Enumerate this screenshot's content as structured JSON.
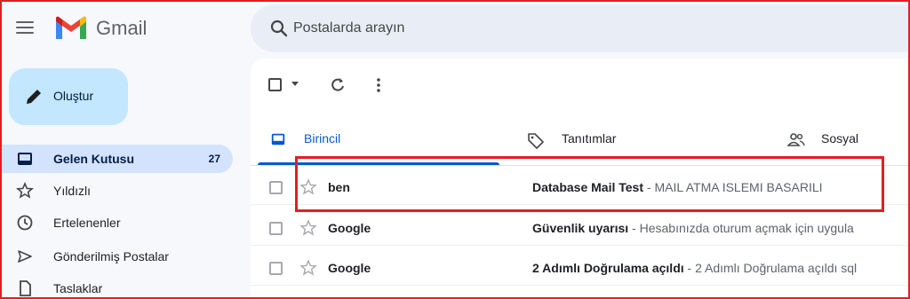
{
  "header": {
    "brand": "Gmail",
    "search_placeholder": "Postalarda arayın"
  },
  "sidebar": {
    "compose_label": "Oluştur",
    "items": [
      {
        "label": "Gelen Kutusu",
        "count": "27",
        "icon": "inbox-icon",
        "active": true
      },
      {
        "label": "Yıldızlı",
        "icon": "star-icon"
      },
      {
        "label": "Ertelenenler",
        "icon": "clock-icon"
      },
      {
        "label": "Gönderilmiş Postalar",
        "icon": "send-icon"
      },
      {
        "label": "Taslaklar",
        "icon": "draft-icon"
      }
    ]
  },
  "tabs": [
    {
      "label": "Birincil",
      "icon": "inbox-icon",
      "active": true
    },
    {
      "label": "Tanıtımlar",
      "icon": "tag-icon"
    },
    {
      "label": "Sosyal",
      "icon": "people-icon"
    }
  ],
  "emails": [
    {
      "sender": "ben",
      "subject": "Database Mail Test",
      "snippet": " - MAIL ATMA ISLEMI BASARILI"
    },
    {
      "sender": "Google",
      "subject": "Güvenlik uyarısı",
      "snippet": " - Hesabınızda oturum açmak için uygula"
    },
    {
      "sender": "Google",
      "subject": "2 Adımlı Doğrulama açıldı",
      "snippet": " - 2 Adımlı Doğrulama açıldı sql"
    }
  ],
  "colors": {
    "accent": "#0b57d0",
    "compose_bg": "#c2e7ff",
    "active_nav_bg": "#d3e3fd",
    "highlight": "#e01f25"
  }
}
